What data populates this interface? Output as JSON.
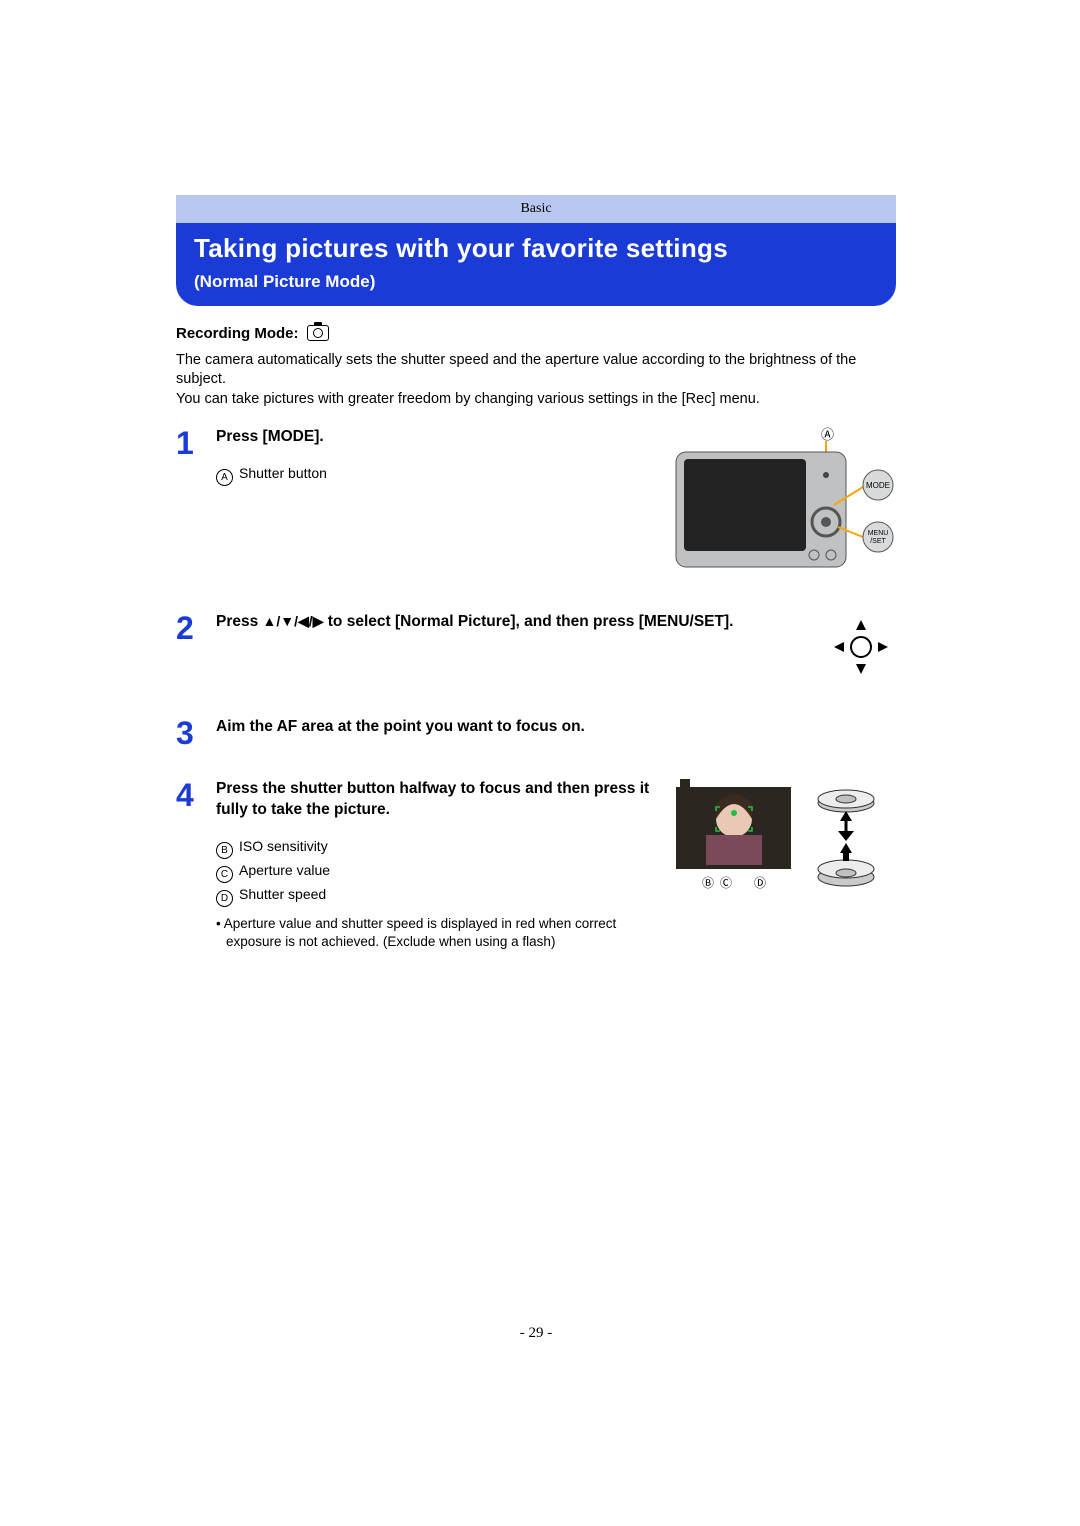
{
  "header": {
    "category": "Basic"
  },
  "title": {
    "main": "Taking pictures with your favorite settings",
    "sub": "(Normal Picture Mode)"
  },
  "intro": {
    "rec_mode_label": "Recording Mode:",
    "p1": "The camera automatically sets the shutter speed and the aperture value according to the brightness of the subject.",
    "p2": "You can take pictures with greater freedom by changing various settings in the [Rec] menu."
  },
  "steps": [
    {
      "num": "1",
      "title": "Press [MODE].",
      "sub": [
        {
          "label": "A",
          "text": "Shutter button"
        }
      ],
      "graphic": {
        "buttons": [
          "MODE",
          "MENU\n/SET"
        ],
        "callout": "A"
      }
    },
    {
      "num": "2",
      "title_pre": "Press ",
      "title_post": " to select [Normal Picture], and then press [MENU/SET].",
      "arrows": "▲/▼/◀/▶"
    },
    {
      "num": "3",
      "title": "Aim the AF area at the point you want to focus on."
    },
    {
      "num": "4",
      "title": "Press the shutter button halfway to focus and then press it fully to take the picture.",
      "sub": [
        {
          "label": "B",
          "text": "ISO sensitivity"
        },
        {
          "label": "C",
          "text": "Aperture value"
        },
        {
          "label": "D",
          "text": "Shutter speed"
        }
      ],
      "note": "• Aperture value and shutter speed is displayed in red when correct exposure is not achieved. (Exclude when using a flash)",
      "graphic": {
        "callouts": [
          "B",
          "C",
          "D"
        ]
      }
    }
  ],
  "page_number": "- 29 -"
}
